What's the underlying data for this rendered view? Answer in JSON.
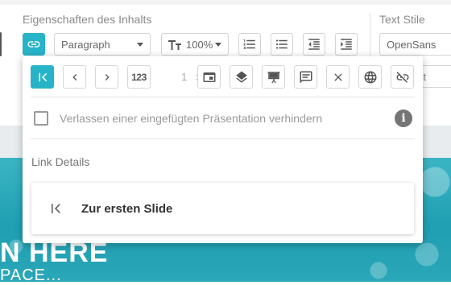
{
  "toolbar": {
    "content_properties_title": "Eigenschaften des Inhalts",
    "text_style_title": "Text Stile",
    "paragraph_dropdown": "Paragraph",
    "font_size_value": "100%",
    "font_family_value": "OpenSans",
    "partial_field_text": "ct"
  },
  "popup": {
    "toolbar_buttons": [
      {
        "name": "first-slide-icon",
        "active": true
      },
      {
        "name": "previous-icon"
      },
      {
        "name": "next-icon"
      },
      {
        "name": "slide-number-icon"
      },
      {
        "name": "window-icon"
      },
      {
        "name": "layers-icon"
      },
      {
        "name": "presentation-icon"
      },
      {
        "name": "caption-icon"
      },
      {
        "name": "close-icon"
      },
      {
        "name": "globe-icon"
      },
      {
        "name": "unlink-icon"
      }
    ],
    "slide_number_icon_label": "123",
    "counter_value": "1",
    "checkbox_label": "Verlassen einer eingefügten Präsentation verhindern",
    "checkbox_checked": false,
    "info_label": "i",
    "link_details_title": "Link Details",
    "link_detail_text": "Zur ersten Slide"
  },
  "slide": {
    "title_fragment": "N HERE",
    "subtitle_fragment": "PACE..."
  },
  "colors": {
    "accent": "#27b3c8",
    "slide_background": "#2aa7b8"
  }
}
